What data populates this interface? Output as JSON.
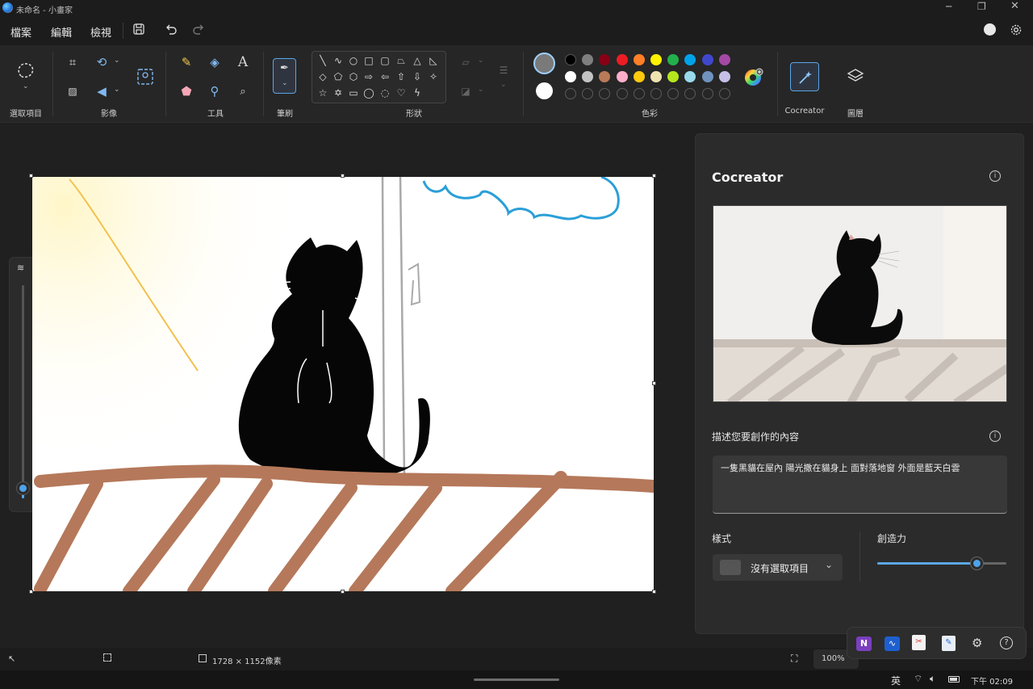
{
  "window": {
    "title": "未命名 - 小畫家"
  },
  "menu": {
    "file": "檔案",
    "edit": "編輯",
    "view": "檢視"
  },
  "ribbon": {
    "select_label": "選取項目",
    "image_label": "影像",
    "tools_label": "工具",
    "brush_label": "筆刷",
    "shapes_label": "形狀",
    "colors_label": "色彩",
    "cocreator_label": "Cocreator",
    "layers_label": "圖層",
    "text_tool_glyph": "A"
  },
  "colors": {
    "primary": "#7a7a7a",
    "secondary": "#ffffff",
    "row1": [
      "#000000",
      "#7f7f7f",
      "#880015",
      "#ed1c24",
      "#ff7f27",
      "#fff200",
      "#22b14c",
      "#00a2e8",
      "#3f48cc",
      "#a349a4"
    ],
    "row2": [
      "#ffffff",
      "#c3c3c3",
      "#b97a57",
      "#ffaec9",
      "#ffc90e",
      "#efe4b0",
      "#b5e61d",
      "#99d9ea",
      "#7092be",
      "#c8bfe7"
    ]
  },
  "panel": {
    "title": "Cocreator",
    "describe_label": "描述您要創作的內容",
    "prompt_text": "一隻黑貓在屋內 陽光撒在貓身上 面對落地窗 外面是藍天白雲",
    "style_label": "樣式",
    "style_value": "沒有選取項目",
    "creativity_label": "創造力",
    "creativity_level": 0.77
  },
  "status": {
    "canvas_size": "1728 × 1152像素",
    "zoom": "100%"
  },
  "taskbar": {
    "ime": "英",
    "time": "下午 02:09"
  },
  "brush_size_level": 0.05
}
